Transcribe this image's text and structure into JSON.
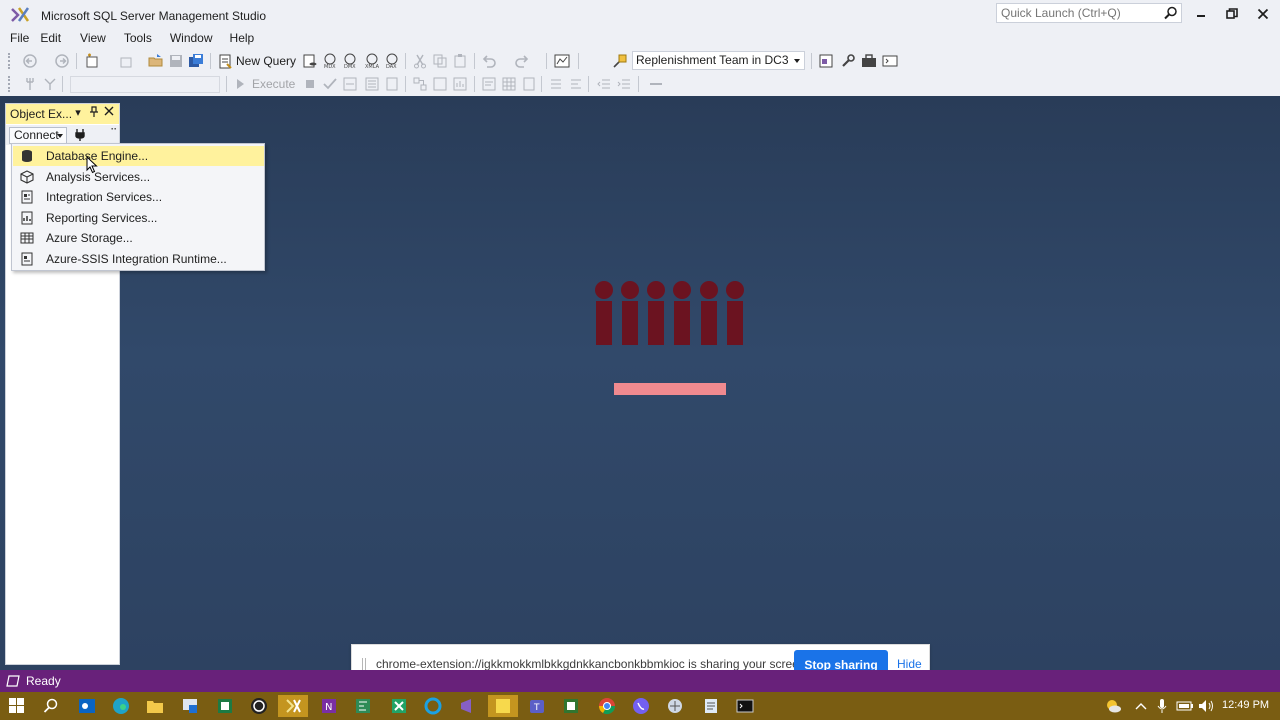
{
  "window": {
    "title": "Microsoft SQL Server Management Studio",
    "quick_launch_placeholder": "Quick Launch (Ctrl+Q)"
  },
  "menu": [
    "File",
    "Edit",
    "View",
    "Tools",
    "Window",
    "Help"
  ],
  "toolbar": {
    "new_query_label": "New Query",
    "database_selector": "Replenishment Team in DC3",
    "execute_label": "Execute"
  },
  "object_explorer": {
    "title": "Object Ex...",
    "connect_label": "Connect"
  },
  "connect_menu": {
    "items": [
      {
        "label": "Database Engine...",
        "icon": "database-icon",
        "selected": true
      },
      {
        "label": "Analysis Services...",
        "icon": "cube-icon",
        "selected": false
      },
      {
        "label": "Integration Services...",
        "icon": "package-icon",
        "selected": false
      },
      {
        "label": "Reporting Services...",
        "icon": "report-icon",
        "selected": false
      },
      {
        "label": "Azure Storage...",
        "icon": "storage-icon",
        "selected": false
      },
      {
        "label": "Azure-SSIS Integration Runtime...",
        "icon": "runtime-icon",
        "selected": false
      }
    ]
  },
  "share_banner": {
    "message": "chrome-extension://igkkmokkmlbkkgdnkkancbonkbbmkioc is sharing your screen.",
    "stop_label": "Stop sharing",
    "hide_label": "Hide"
  },
  "status": {
    "text": "Ready"
  },
  "taskbar": {
    "time": "12:49 PM"
  },
  "colors": {
    "accent_highlight": "#fff29d",
    "status_bar": "#68217a",
    "main_background": "#2d4261",
    "share_button": "#1a73e8",
    "taskbar": "#7a5d12"
  }
}
